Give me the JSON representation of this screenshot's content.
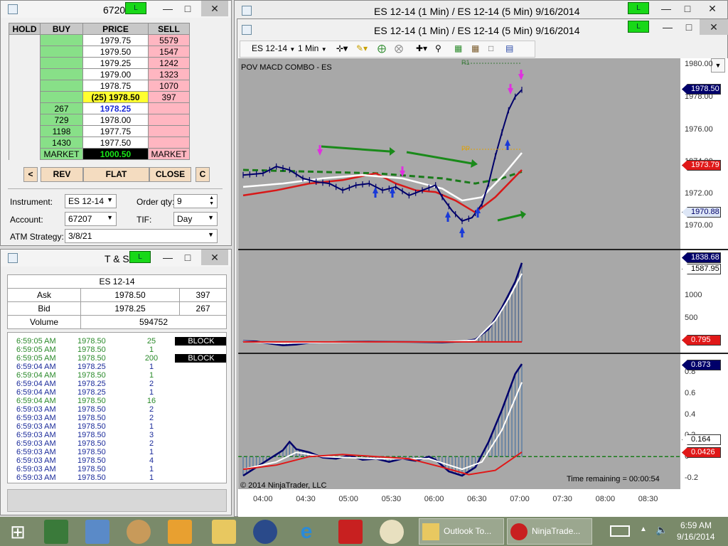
{
  "dom_window": {
    "title": "6720",
    "badge": "L",
    "headers": {
      "hold": "HOLD",
      "buy": "BUY",
      "price": "PRICE",
      "sell": "SELL"
    },
    "rows": [
      {
        "buy": "",
        "price": "1979.75",
        "sell": "5579"
      },
      {
        "buy": "",
        "price": "1979.50",
        "sell": "1547"
      },
      {
        "buy": "",
        "price": "1979.25",
        "sell": "1242"
      },
      {
        "buy": "",
        "price": "1979.00",
        "sell": "1323"
      },
      {
        "buy": "",
        "price": "1978.75",
        "sell": "1070"
      },
      {
        "buy": "",
        "price": "(25) 1978.50",
        "sell": "397"
      },
      {
        "buy": "267",
        "price": "1978.25",
        "sell": ""
      },
      {
        "buy": "729",
        "price": "1978.00",
        "sell": ""
      },
      {
        "buy": "1198",
        "price": "1977.75",
        "sell": ""
      },
      {
        "buy": "1430",
        "price": "1977.50",
        "sell": ""
      },
      {
        "buy": "MARKET",
        "price": "1000.50",
        "sell": "MARKET"
      }
    ],
    "buttons": {
      "left": "<",
      "rev": "REV",
      "flat": "FLAT",
      "close": "CLOSE",
      "c": "C"
    },
    "instrument_label": "Instrument:",
    "instrument_value": "ES 12-14",
    "order_qty_label": "Order qty:",
    "order_qty_value": "9",
    "account_label": "Account:",
    "account_value": "67207",
    "tif_label": "TIF:",
    "tif_value": "Day",
    "atm_label": "ATM Strategy:",
    "atm_value": "3/8/21"
  },
  "ts_window": {
    "title": "T & S",
    "badge": "L",
    "instrument": "ES 12-14",
    "ask_label": "Ask",
    "ask_price": "1978.50",
    "ask_size": "397",
    "bid_label": "Bid",
    "bid_price": "1978.25",
    "bid_size": "267",
    "volume_label": "Volume",
    "volume_value": "594752",
    "trades": [
      {
        "time": "6:59:05 AM",
        "price": "1978.50",
        "size": "25",
        "block": "BLOCK",
        "color": "#2a8a2a"
      },
      {
        "time": "6:59:05 AM",
        "price": "1978.50",
        "size": "1",
        "block": "",
        "color": "#2a8a2a"
      },
      {
        "time": "6:59:05 AM",
        "price": "1978.50",
        "size": "200",
        "block": "BLOCK",
        "color": "#2a8a2a"
      },
      {
        "time": "6:59:04 AM",
        "price": "1978.25",
        "size": "1",
        "block": "",
        "color": "#1a2a9a"
      },
      {
        "time": "6:59:04 AM",
        "price": "1978.50",
        "size": "1",
        "block": "",
        "color": "#2a8a2a"
      },
      {
        "time": "6:59:04 AM",
        "price": "1978.25",
        "size": "2",
        "block": "",
        "color": "#1a2a9a"
      },
      {
        "time": "6:59:04 AM",
        "price": "1978.25",
        "size": "1",
        "block": "",
        "color": "#1a2a9a"
      },
      {
        "time": "6:59:04 AM",
        "price": "1978.50",
        "size": "16",
        "block": "",
        "color": "#2a8a2a"
      },
      {
        "time": "6:59:03 AM",
        "price": "1978.50",
        "size": "2",
        "block": "",
        "color": "#1a2a9a"
      },
      {
        "time": "6:59:03 AM",
        "price": "1978.50",
        "size": "2",
        "block": "",
        "color": "#1a2a9a"
      },
      {
        "time": "6:59:03 AM",
        "price": "1978.50",
        "size": "1",
        "block": "",
        "color": "#1a2a9a"
      },
      {
        "time": "6:59:03 AM",
        "price": "1978.50",
        "size": "3",
        "block": "",
        "color": "#1a2a9a"
      },
      {
        "time": "6:59:03 AM",
        "price": "1978.50",
        "size": "2",
        "block": "",
        "color": "#1a2a9a"
      },
      {
        "time": "6:59:03 AM",
        "price": "1978.50",
        "size": "1",
        "block": "",
        "color": "#1a2a9a"
      },
      {
        "time": "6:59:03 AM",
        "price": "1978.50",
        "size": "4",
        "block": "",
        "color": "#1a2a9a"
      },
      {
        "time": "6:59:03 AM",
        "price": "1978.50",
        "size": "1",
        "block": "",
        "color": "#1a2a9a"
      },
      {
        "time": "6:59:03 AM",
        "price": "1978.50",
        "size": "1",
        "block": "",
        "color": "#1a2a9a"
      }
    ]
  },
  "chart_window": {
    "title_back": "ES 12-14 (1 Min) / ES 12-14 (5 Min)  9/16/2014",
    "title_front": "ES 12-14 (1 Min) / ES 12-14 (5 Min)  9/16/2014",
    "badge": "L",
    "toolbar": {
      "instrument": "ES 12-14",
      "interval": "1 Min"
    },
    "indicator_label": "POV MACD COMBO - ES",
    "pp_label": "PP",
    "r1_label": "R1",
    "copyright": "© 2014 NinjaTrader, LLC",
    "time_remaining": "Time remaining = 00:00:54",
    "colors": {
      "panel_bg": "#a8a8a8",
      "price_line": "#00006a",
      "ema_red": "#d81818",
      "ema_white": "#ffffff",
      "ema_green_dashed": "#1a7a1a",
      "up_arrow": "#1a3ad8",
      "down_arrow": "#e030e0"
    }
  },
  "chart_data": [
    {
      "type": "line",
      "title": "POV MACD COMBO - ES",
      "x_ticks": [
        "04:00",
        "04:30",
        "05:00",
        "05:30",
        "06:00",
        "06:30",
        "07:00",
        "07:30",
        "08:00",
        "08:30"
      ],
      "y_ticks": [
        "1980.00",
        "1978.00",
        "1976.00",
        "1974.00",
        "1972.00",
        "1970.00"
      ],
      "ylim": [
        1969.5,
        1980.1
      ],
      "value_tags": [
        "1978.50",
        "1973.79",
        "1970.88"
      ],
      "series": [
        {
          "values": [
            [
              0,
              1973.5
            ],
            [
              6,
              1973.6
            ],
            [
              10,
              1974.0
            ],
            [
              14,
              1973.8
            ],
            [
              18,
              1973.3
            ],
            [
              22,
              1973.1
            ],
            [
              26,
              1973.0
            ],
            [
              30,
              1972.6
            ],
            [
              34,
              1972.9
            ],
            [
              38,
              1973.0
            ],
            [
              42,
              1972.6
            ],
            [
              46,
              1972.8
            ],
            [
              50,
              1972.3
            ],
            [
              54,
              1972.6
            ],
            [
              58,
              1972.9
            ],
            [
              60,
              1972.2
            ],
            [
              63,
              1971.4
            ],
            [
              66,
              1970.8
            ],
            [
              69,
              1971.0
            ],
            [
              72,
              1971.8
            ],
            [
              74,
              1973.0
            ],
            [
              76,
              1974.6
            ],
            [
              78,
              1976.0
            ],
            [
              80,
              1977.3
            ],
            [
              82,
              1978.1
            ],
            [
              84,
              1978.5
            ]
          ]
        },
        {
          "values": [
            [
              0,
              1972.3
            ],
            [
              10,
              1972.6
            ],
            [
              20,
              1973.0
            ],
            [
              30,
              1973.2
            ],
            [
              40,
              1973.6
            ],
            [
              46,
              1973.0
            ],
            [
              52,
              1972.6
            ],
            [
              58,
              1972.5
            ],
            [
              64,
              1972.0
            ],
            [
              70,
              1971.3
            ],
            [
              76,
              1972.2
            ],
            [
              80,
              1973.0
            ],
            [
              84,
              1973.8
            ]
          ]
        },
        {
          "values": [
            [
              0,
              1972.8
            ],
            [
              12,
              1973.0
            ],
            [
              24,
              1973.3
            ],
            [
              36,
              1973.5
            ],
            [
              48,
              1973.3
            ],
            [
              60,
              1972.7
            ],
            [
              66,
              1972.0
            ],
            [
              72,
              1972.2
            ],
            [
              78,
              1973.4
            ],
            [
              84,
              1974.8
            ]
          ]
        },
        {
          "values": [
            [
              0,
              1973.8
            ],
            [
              20,
              1973.7
            ],
            [
              40,
              1973.6
            ],
            [
              60,
              1973.3
            ],
            [
              70,
              1973.0
            ],
            [
              78,
              1973.3
            ],
            [
              84,
              1973.7
            ]
          ]
        }
      ]
    },
    {
      "type": "area",
      "y_ticks": [
        "1000",
        "500"
      ],
      "ylim": [
        -150,
        2000
      ],
      "value_tags": [
        "1838.68",
        "1587.95",
        "0.795"
      ],
      "series": [
        {
          "values": [
            [
              0,
              20
            ],
            [
              4,
              10
            ],
            [
              8,
              -40
            ],
            [
              12,
              -80
            ],
            [
              16,
              -60
            ],
            [
              20,
              -20
            ],
            [
              30,
              0
            ],
            [
              40,
              5
            ],
            [
              50,
              0
            ],
            [
              60,
              -10
            ],
            [
              66,
              10
            ],
            [
              70,
              60
            ],
            [
              74,
              300
            ],
            [
              78,
              800
            ],
            [
              82,
              1400
            ],
            [
              84,
              1838.68
            ]
          ]
        },
        {
          "values": [
            [
              0,
              10
            ],
            [
              10,
              -30
            ],
            [
              20,
              -20
            ],
            [
              40,
              0
            ],
            [
              60,
              0
            ],
            [
              70,
              40
            ],
            [
              76,
              500
            ],
            [
              80,
              1000
            ],
            [
              84,
              1587.95
            ]
          ]
        },
        {
          "values": [
            [
              0,
              0.795
            ],
            [
              84,
              0.795
            ]
          ]
        }
      ]
    },
    {
      "type": "area",
      "y_ticks": [
        "0.8",
        "0.6",
        "0.4",
        "0.2",
        "0",
        "-0.2"
      ],
      "ylim": [
        -0.28,
        0.9
      ],
      "value_tags": [
        "0.873",
        "0.164",
        "0.0426"
      ],
      "series": [
        {
          "values": [
            [
              0,
              -0.18
            ],
            [
              4,
              -0.1
            ],
            [
              8,
              -0.02
            ],
            [
              12,
              0.06
            ],
            [
              14,
              0.14
            ],
            [
              16,
              0.07
            ],
            [
              20,
              0.04
            ],
            [
              24,
              -0.01
            ],
            [
              28,
              -0.02
            ],
            [
              32,
              0.01
            ],
            [
              36,
              -0.03
            ],
            [
              40,
              -0.02
            ],
            [
              44,
              -0.05
            ],
            [
              48,
              -0.02
            ],
            [
              52,
              -0.04
            ],
            [
              56,
              0.0
            ],
            [
              58,
              -0.03
            ],
            [
              62,
              -0.14
            ],
            [
              66,
              -0.18
            ],
            [
              70,
              -0.1
            ],
            [
              74,
              0.14
            ],
            [
              78,
              0.44
            ],
            [
              82,
              0.78
            ],
            [
              84,
              0.873
            ]
          ]
        },
        {
          "values": [
            [
              0,
              -0.12
            ],
            [
              10,
              -0.05
            ],
            [
              16,
              0.04
            ],
            [
              24,
              0.0
            ],
            [
              40,
              -0.02
            ],
            [
              56,
              -0.02
            ],
            [
              66,
              -0.12
            ],
            [
              72,
              -0.05
            ],
            [
              78,
              0.25
            ],
            [
              84,
              0.7
            ]
          ]
        },
        {
          "values": [
            [
              0,
              -0.12
            ],
            [
              10,
              -0.08
            ],
            [
              20,
              0.0
            ],
            [
              30,
              0.02
            ],
            [
              40,
              0.0
            ],
            [
              50,
              -0.02
            ],
            [
              60,
              -0.1
            ],
            [
              68,
              -0.17
            ],
            [
              76,
              -0.13
            ],
            [
              84,
              0.0426
            ]
          ]
        }
      ]
    }
  ],
  "taskbar": {
    "outlook": "Outlook To...",
    "ninja": "NinjaTrade...",
    "time": "6:59 AM",
    "date": "9/16/2014"
  }
}
